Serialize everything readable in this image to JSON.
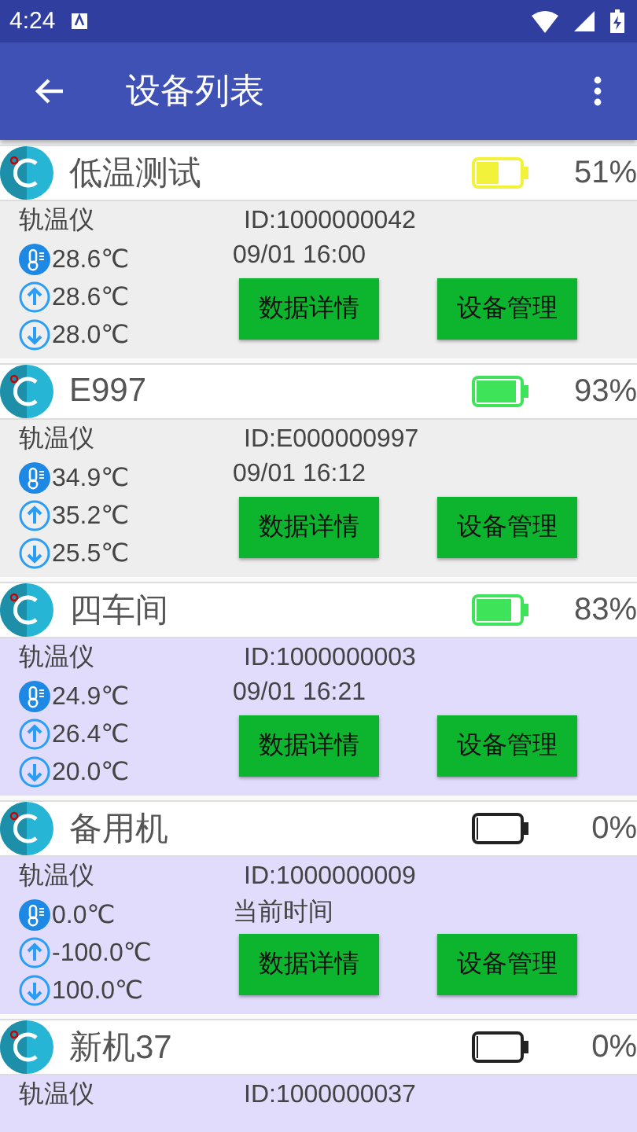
{
  "status_bar": {
    "time": "4:24"
  },
  "toolbar": {
    "title": "设备列表"
  },
  "devices": [
    {
      "name": "低温测试",
      "battery": {
        "level": 0.51,
        "color": "#f2f23a"
      },
      "percent": "51%",
      "color": "#eeeeee",
      "type": "轨温仪",
      "id": "ID:1000000042",
      "temp": "28.6℃",
      "time": "09/01 16:00",
      "max": "28.6℃",
      "min": "28.0℃",
      "buttons": [
        "数据详情",
        "设备管理"
      ]
    },
    {
      "name": "E997",
      "battery": {
        "level": 0.93,
        "color": "#3ee35a"
      },
      "percent": "93%",
      "color": "#eeeeee",
      "type": "轨温仪",
      "id": "ID:E000000997",
      "temp": "34.9℃",
      "time": "09/01 16:12",
      "max": "35.2℃",
      "min": "25.5℃",
      "buttons": [
        "数据详情",
        "设备管理"
      ]
    },
    {
      "name": "四车间",
      "battery": {
        "level": 0.83,
        "color": "#3ee35a"
      },
      "percent": "83%",
      "color": "#e1dcfb",
      "type": "轨温仪",
      "id": "ID:1000000003",
      "temp": "24.9℃",
      "time": "09/01 16:21",
      "max": "26.4℃",
      "min": "20.0℃",
      "buttons": [
        "数据详情",
        "设备管理"
      ]
    },
    {
      "name": "备用机",
      "battery": {
        "level": 0,
        "color": "#222222"
      },
      "percent": "0%",
      "color": "#e1dcfb",
      "type": "轨温仪",
      "id": "ID:1000000009",
      "temp": "0.0℃",
      "time": "当前时间",
      "max": "-100.0℃",
      "min": "100.0℃",
      "buttons": [
        "数据详情",
        "设备管理"
      ]
    },
    {
      "name": "新机37",
      "battery": {
        "level": 0,
        "color": "#222222"
      },
      "percent": "0%",
      "color": "#e1dcfb",
      "type": "轨温仪",
      "id": "ID:1000000037"
    }
  ]
}
